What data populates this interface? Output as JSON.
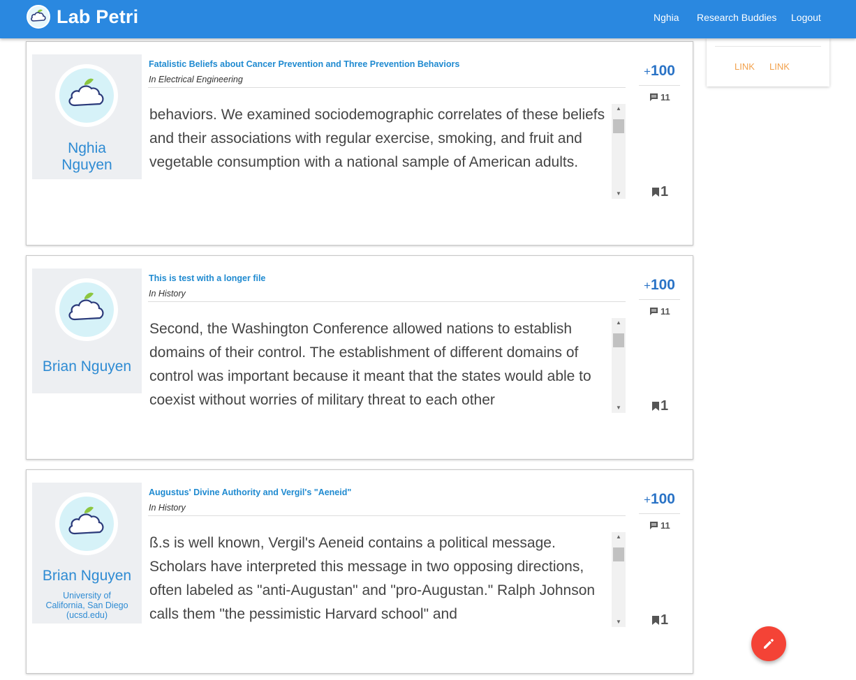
{
  "app": {
    "brand": "Lab Petri"
  },
  "nav": {
    "user": "Nghia",
    "buddies": "Research Buddies",
    "logout": "Logout"
  },
  "side_card": {
    "links": [
      "LINK",
      "LINK"
    ]
  },
  "posts": [
    {
      "author_lines": [
        "Nghia",
        "Nguyen"
      ],
      "affiliation_lines": [],
      "title": "Fatalistic Beliefs about Cancer Prevention and Three Prevention Behaviors",
      "category": "In Electrical Engineering",
      "excerpt": "behaviors. We examined sociodemographic correlates of these beliefs and their associations with regular exercise, smoking, and fruit and vegetable consumption with a national sample of American adults.",
      "score_prefix": "+",
      "score": "100",
      "comments": "11",
      "bookmarks": "1"
    },
    {
      "author_lines": [
        "Brian Nguyen"
      ],
      "affiliation_lines": [],
      "title": "This is test with a longer file",
      "category": "In History",
      "excerpt": "Second, the Washington Conference allowed nations to establish domains of their control. The establishment of different domains of control was important because it meant that the states would able to coexist without worries of military threat to each other",
      "score_prefix": "+",
      "score": "100",
      "comments": "11",
      "bookmarks": "1"
    },
    {
      "author_lines": [
        "Brian Nguyen"
      ],
      "affiliation_lines": [
        "University of",
        "California, San Diego",
        "(ucsd.edu)"
      ],
      "title": "Augustus' Divine Authority and Vergil's \"Aeneid\"",
      "category": "In History",
      "excerpt": "ß.s is well known, Vergil's Aeneid contains a political message. Scholars have interpreted this message in two opposing directions, often labeled as \"anti-Augustan\" and \"pro-Augustan.\" Ralph Johnson calls them \"the pessimistic Harvard school\" and",
      "score_prefix": "+",
      "score": "100",
      "comments": "11",
      "bookmarks": "1"
    }
  ],
  "icons": {
    "brand": "cloud-leaf-logo-icon",
    "avatar": "cloud-leaf-avatar-icon",
    "comments": "comment-icon",
    "bookmarks": "bookmark-icon",
    "fab": "pencil-icon"
  },
  "colors": {
    "topbar": "#2a88e0",
    "link_blue": "#1f8ad0",
    "score_blue": "#2a73c6",
    "side_link": "#f2a14c",
    "fab": "#f44336"
  }
}
